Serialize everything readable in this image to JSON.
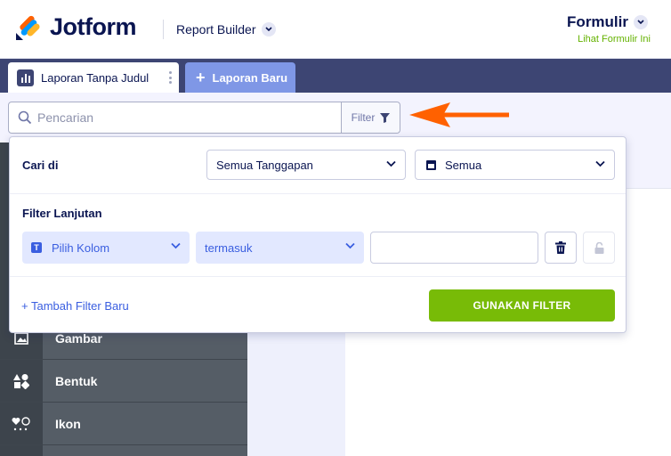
{
  "header": {
    "brand": "Jotform",
    "app_switcher_label": "Report Builder",
    "form_title": "Formulir",
    "form_link": "Lihat Formulir Ini"
  },
  "tabs": {
    "active_label": "Laporan Tanpa Judul",
    "new_tab_label": "Laporan Baru"
  },
  "search": {
    "placeholder": "Pencarian",
    "filter_label": "Filter"
  },
  "filter_popup": {
    "search_in_label": "Cari di",
    "responses_select": "Semua Tanggapan",
    "date_select": "Semua",
    "advanced_label": "Filter Lanjutan",
    "column_select": "Pilih Kolom",
    "operator_select": "termasuk",
    "value_input": "",
    "add_filter_label": "+ Tambah Filter Baru",
    "apply_button": "GUNAKAN FILTER"
  },
  "sidebar": {
    "items": [
      {
        "label": "Gambar",
        "icon": "image-icon"
      },
      {
        "label": "Bentuk",
        "icon": "shapes-icon"
      },
      {
        "label": "Ikon",
        "icon": "emoji-icon"
      }
    ]
  },
  "colors": {
    "navy": "#0a1551",
    "tabbar": "#3d4573",
    "new_tab": "#7f97e6",
    "apply_green": "#78bb07",
    "link_green": "#64b200",
    "accent_blue": "#3a5ee0",
    "arrow_orange": "#ff6100",
    "sidebar": "#555d66"
  }
}
